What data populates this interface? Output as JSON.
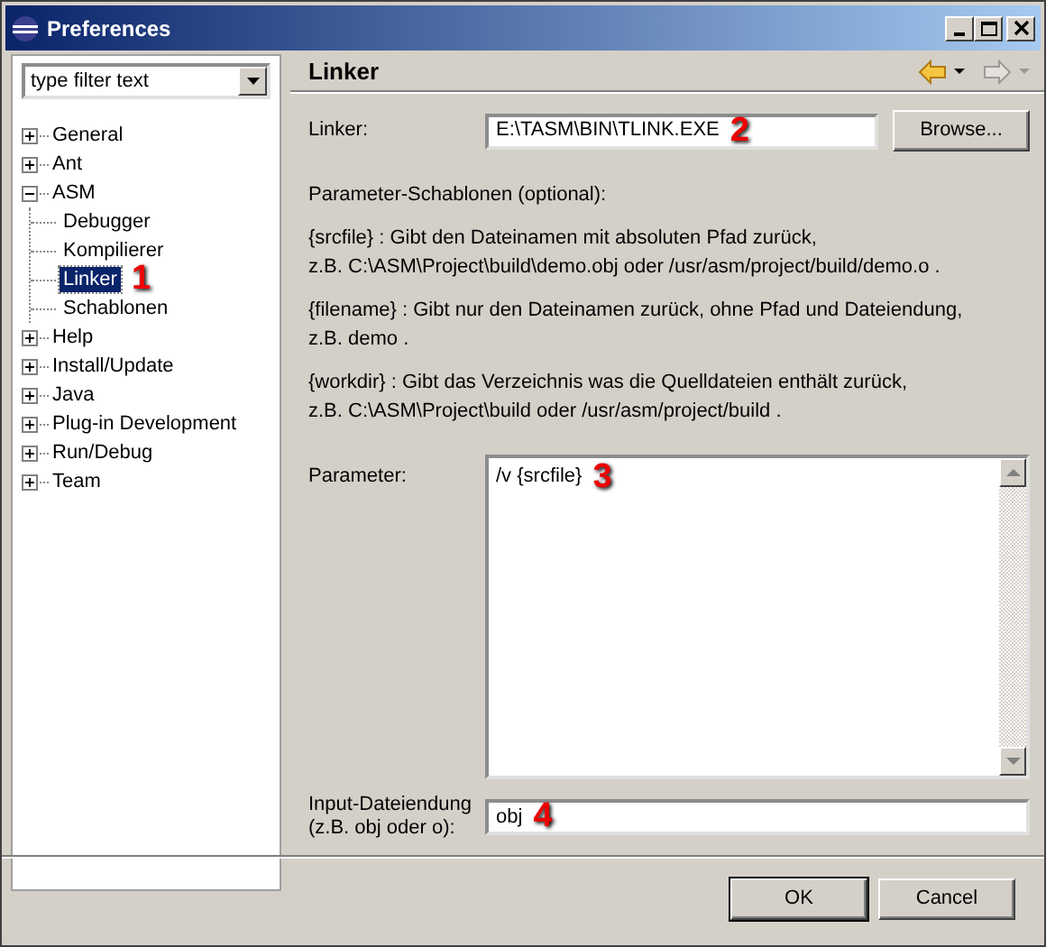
{
  "window": {
    "title": "Preferences"
  },
  "filter": {
    "value": "type filter text"
  },
  "tree": [
    {
      "label": "General",
      "expanded": false,
      "selected": false
    },
    {
      "label": "Ant",
      "expanded": false,
      "selected": false
    },
    {
      "label": "ASM",
      "expanded": true,
      "selected": false,
      "children": [
        {
          "label": "Debugger",
          "selected": false
        },
        {
          "label": "Kompilierer",
          "selected": false
        },
        {
          "label": "Linker",
          "selected": true,
          "annotation": "1"
        },
        {
          "label": "Schablonen",
          "selected": false
        }
      ]
    },
    {
      "label": "Help",
      "expanded": false,
      "selected": false
    },
    {
      "label": "Install/Update",
      "expanded": false,
      "selected": false
    },
    {
      "label": "Java",
      "expanded": false,
      "selected": false
    },
    {
      "label": "Plug-in Development",
      "expanded": false,
      "selected": false
    },
    {
      "label": "Run/Debug",
      "expanded": false,
      "selected": false
    },
    {
      "label": "Team",
      "expanded": false,
      "selected": false
    }
  ],
  "page": {
    "title": "Linker",
    "back_enabled": true,
    "forward_enabled": false
  },
  "linker": {
    "label": "Linker:",
    "value": "E:\\TASM\\BIN\\TLINK.EXE",
    "annotation": "2",
    "browse": "Browse..."
  },
  "intro": "Parameter-Schablonen (optional):",
  "templates": [
    {
      "lines": [
        "{srcfile} :  Gibt den Dateinamen mit absoluten Pfad zurück,",
        "z.B. C:\\ASM\\Project\\build\\demo.obj oder /usr/asm/project/build/demo.o ."
      ]
    },
    {
      "lines": [
        "{filename} :  Gibt nur den Dateinamen zurück, ohne Pfad und Dateiendung,",
        "z.B. demo ."
      ]
    },
    {
      "lines": [
        "{workdir} :  Gibt das Verzeichnis was die Quelldateien enthält zurück,",
        "z.B. C:\\ASM\\Project\\build oder /usr/asm/project/build ."
      ]
    }
  ],
  "parameter": {
    "label": "Parameter:",
    "value": "/v {srcfile}",
    "annotation": "3"
  },
  "extension": {
    "label_lines": [
      "Input-Dateiendung",
      "(z.B. obj oder o):"
    ],
    "value": "obj",
    "annotation": "4"
  },
  "buttons": [
    {
      "label": "OK",
      "default": true
    },
    {
      "label": "Cancel",
      "default": false
    }
  ]
}
